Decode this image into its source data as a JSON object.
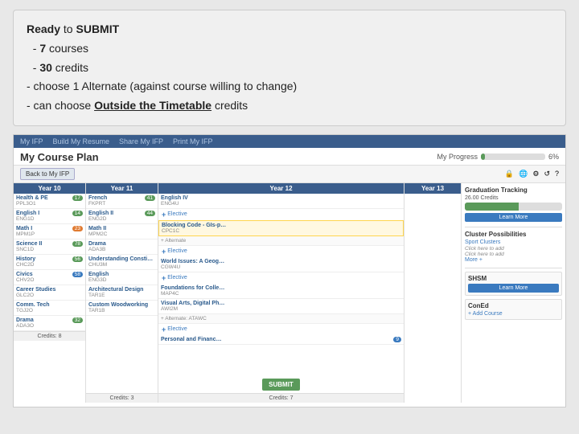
{
  "infoCard": {
    "line1_prefix": "Ready",
    "line1_suffix": " to ",
    "line1_action": "SUBMIT",
    "line2_number": "7",
    "line2_text": " courses",
    "line3_number": "30",
    "line3_text": " credits",
    "line4": "- choose 1 Alternate (against course willing to change)",
    "line5_prefix": "- can choose ",
    "line5_link": "Outside the Timetable",
    "line5_suffix": " credits"
  },
  "innerApp": {
    "navItems": [
      "My IFP",
      "Build My Resume",
      "Share My IFP",
      "Print My IFP"
    ],
    "planTitle": "My Course Plan",
    "progressLabel": "My Progress",
    "progressPercent": "6%",
    "toolbarButtons": [
      "Back to My IFP"
    ],
    "icons": [
      "lock",
      "globe",
      "settings",
      "refresh",
      "help"
    ],
    "years": [
      "Year 10",
      "Year 11",
      "Year 12",
      "Year 13"
    ],
    "year10Courses": [
      {
        "name": "Health & PE",
        "code": "PPL3O1",
        "credits": "17"
      },
      {
        "name": "English I",
        "code": "ENG1D",
        "credits": "14"
      },
      {
        "name": "Math I",
        "code": "MPM1P",
        "credits": "23"
      },
      {
        "name": "Science II",
        "code": "SNC1D",
        "credits": "78"
      },
      {
        "name": "History",
        "code": "CHC2D",
        "credits": "56"
      },
      {
        "name": "Civics",
        "code": "CHV2O",
        "credits": "58"
      },
      {
        "name": "Career Studies",
        "code": "GLC2O",
        "credits": ""
      },
      {
        "name": "Communications Tech",
        "code": "TGJ2O",
        "credits": ""
      },
      {
        "name": "Drama",
        "code": "ADA3O",
        "credits": "32"
      }
    ],
    "year10CreditsLabel": "Credits: 8",
    "year11Courses": [
      {
        "name": "French",
        "code": "FKPRT",
        "credits": "41"
      },
      {
        "name": "English II",
        "code": "ENG2D",
        "credits": "44"
      },
      {
        "name": "Math II",
        "code": "MPM2C",
        "credits": ""
      },
      {
        "name": "Drama",
        "code": "ADA3B",
        "credits": ""
      },
      {
        "name": "Understanding Consti...",
        "code": "CHU3M",
        "credits": ""
      },
      {
        "name": "English",
        "code": "ENG3D",
        "credits": ""
      },
      {
        "name": "Architectural Design",
        "code": "TAR1E",
        "credits": ""
      },
      {
        "name": "Custom Woodworking",
        "code": "TAR1B",
        "credits": ""
      }
    ],
    "year11CreditsLabel": "Credits: 3",
    "year12Courses": [
      {
        "name": "English IV",
        "code": "ENG4U",
        "credits": ""
      },
      {
        "name": "Blocking Code - GIs-p...",
        "code": "CPC1C",
        "credits": ""
      },
      {
        "name": "+ Alternate",
        "code": "",
        "credits": ""
      },
      {
        "name": "World Issues: A Geog...",
        "code": "CGW4U",
        "credits": ""
      },
      {
        "name": "Foundations for Colle...",
        "code": "MAP4C",
        "credits": ""
      },
      {
        "name": "Visual Arts, Digital Ph...",
        "code": "AWI2M",
        "credits": ""
      },
      {
        "name": "+ Alternate: ATAWC",
        "code": "",
        "credits": ""
      },
      {
        "name": "Personal and Financi...",
        "code": "",
        "credits": "9"
      }
    ],
    "addButtons12": [
      "+ Elective",
      "+ Elective",
      "+ Elective",
      "+ Elective"
    ],
    "credits12Label": "Credits: 7",
    "year13Courses": [],
    "graduationTracking": {
      "title": "Graduation Tracking",
      "creditsLabel": "26.00 Credits",
      "learnMoreLabel": "Learn More"
    },
    "clusterPossibilities": {
      "title": "Cluster Possibilities",
      "items": [
        "Sport Clusters",
        "Click here to add",
        "Click here to add",
        "More +"
      ]
    },
    "shsm": {
      "title": "SHSM",
      "learnMoreLabel": "Learn More"
    },
    "conEd": {
      "title": "ConEd",
      "addCourseLabel": "+ Add Course"
    },
    "submitLabel": "SUBMIT"
  }
}
